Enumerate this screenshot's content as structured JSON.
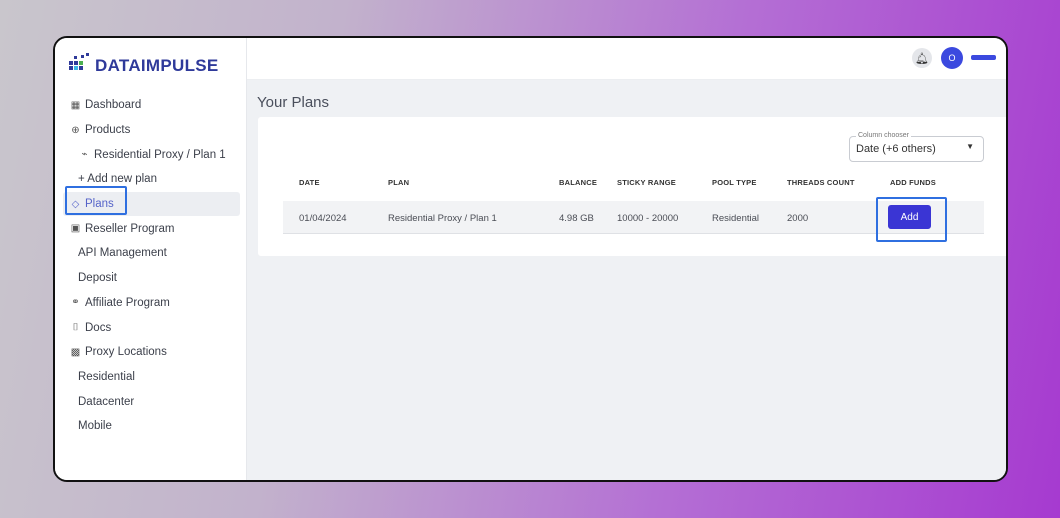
{
  "brand": {
    "name": "DATAIMPULSE"
  },
  "sidebar": {
    "items": [
      {
        "label": "Dashboard",
        "icon": "dashboard-icon"
      },
      {
        "label": "Products",
        "icon": "globe-icon"
      },
      {
        "label": "Residential Proxy / Plan 1",
        "icon": "plug-icon"
      },
      {
        "label": "+ Add new plan"
      },
      {
        "label": "Plans",
        "icon": "tag-icon",
        "active": true
      },
      {
        "label": "Reseller Program",
        "icon": "reseller-icon"
      },
      {
        "label": "API Management"
      },
      {
        "label": "Deposit"
      },
      {
        "label": "Affiliate Program",
        "icon": "handshake-icon"
      },
      {
        "label": "Docs",
        "icon": "docs-icon"
      },
      {
        "label": "Proxy Locations",
        "icon": "grid-icon"
      },
      {
        "label": "Residential"
      },
      {
        "label": "Datacenter"
      },
      {
        "label": "Mobile"
      }
    ]
  },
  "header": {
    "avatar_initial": "O"
  },
  "main": {
    "title": "Your Plans",
    "column_chooser": {
      "label": "Column chooser",
      "value": "Date (+6 others)"
    },
    "table": {
      "headers": [
        "DATE",
        "PLAN",
        "BALANCE",
        "STICKY RANGE",
        "POOL TYPE",
        "THREADS COUNT",
        "ADD FUNDS"
      ],
      "rows": [
        {
          "date": "01/04/2024",
          "plan": "Residential Proxy / Plan 1",
          "balance": "4.98 GB",
          "sticky_range": "10000 - 20000",
          "pool_type": "Residential",
          "threads": "2000",
          "action": "Add"
        }
      ]
    }
  },
  "colors": {
    "brand": "#2f3a9a",
    "accent": "#3a35d4",
    "highlight": "#2f6fe0"
  }
}
